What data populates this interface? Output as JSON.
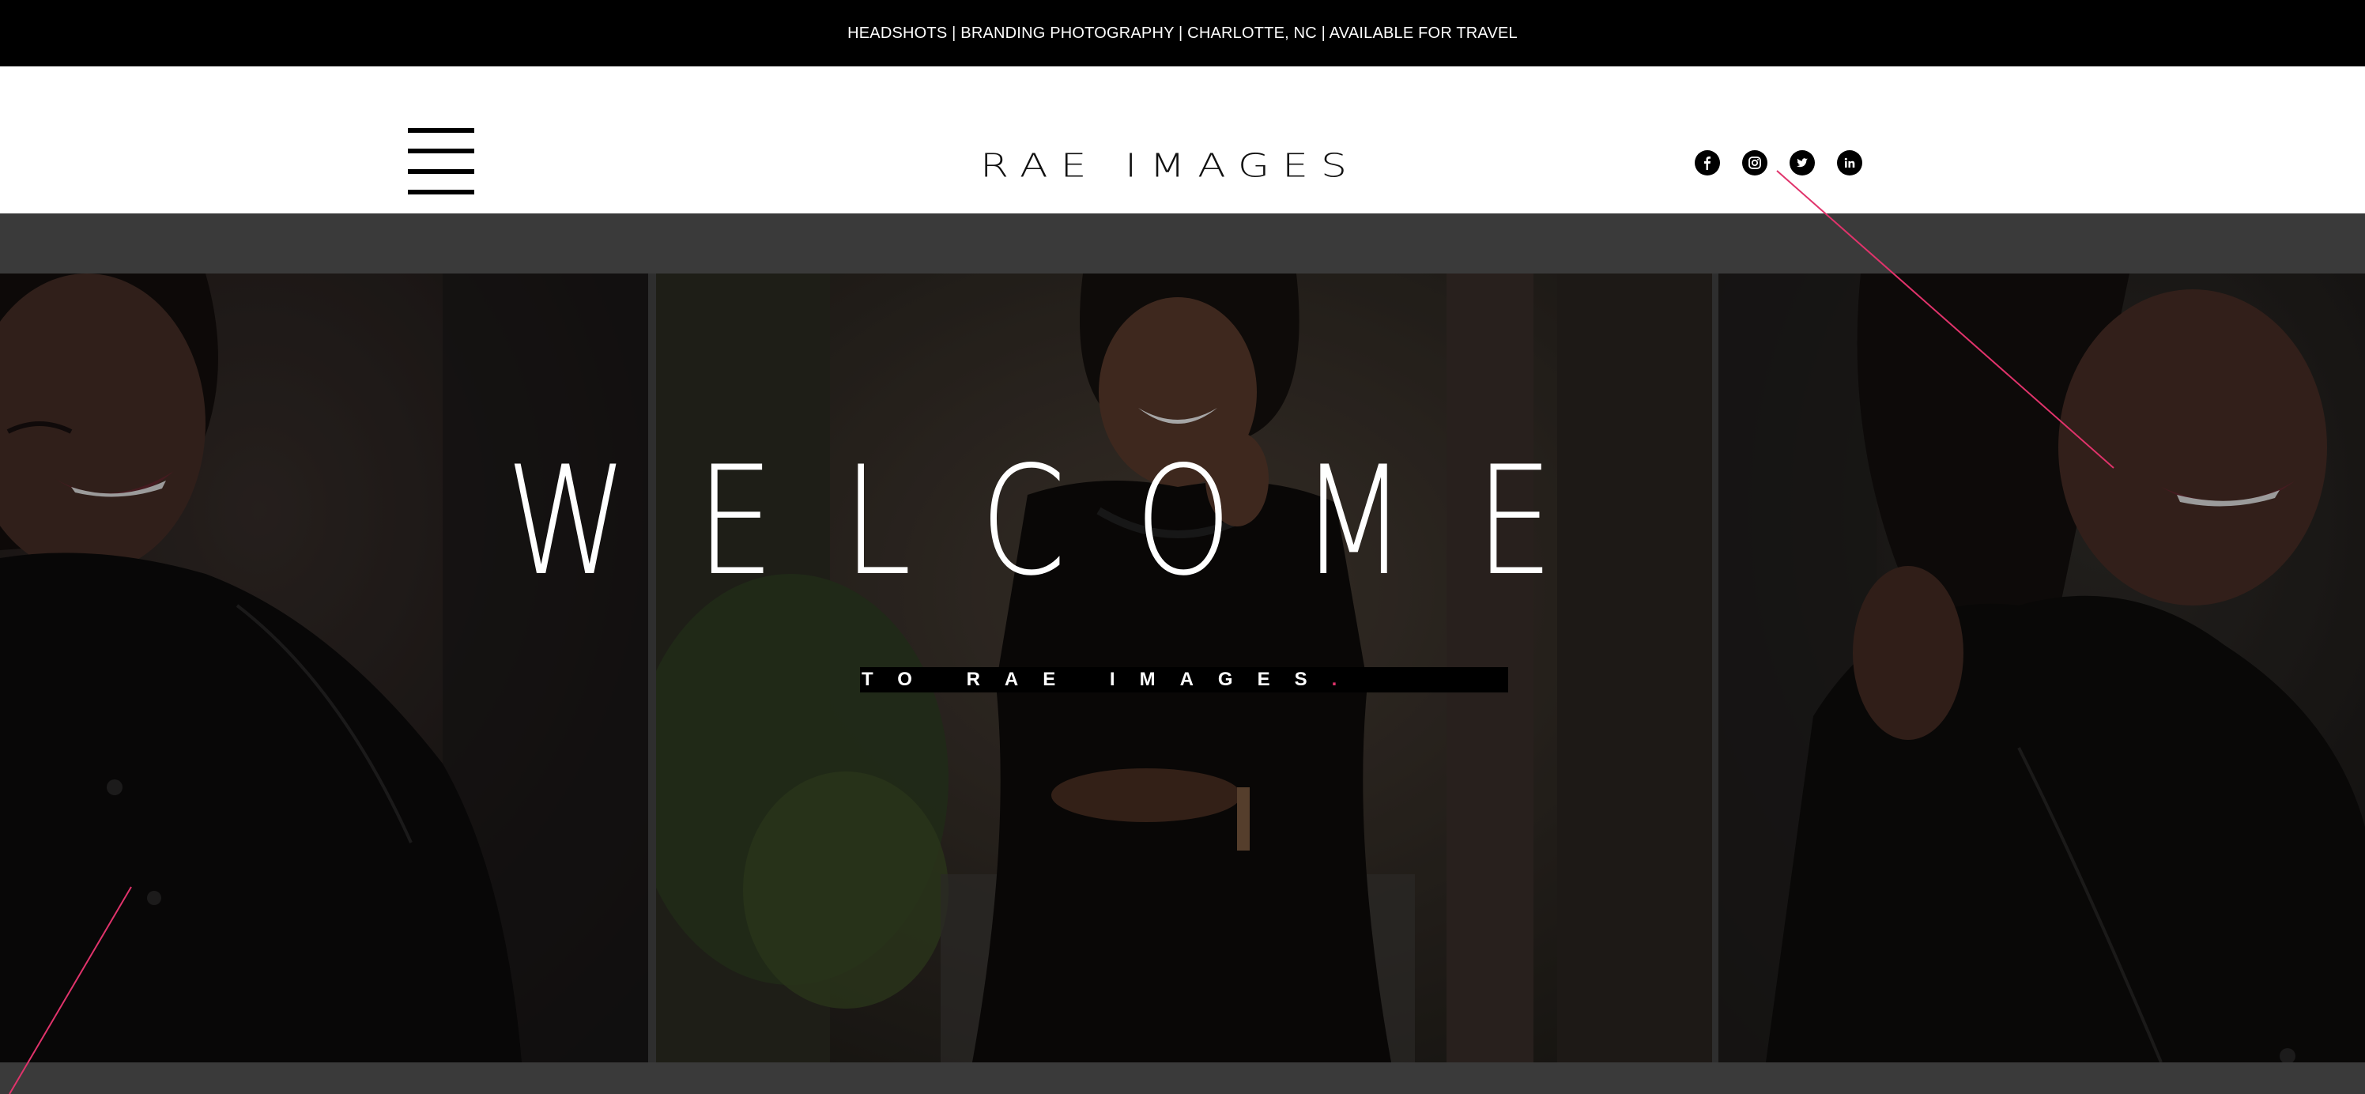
{
  "topbar": {
    "text": "HEADSHOTS | BRANDING PHOTOGRAPHY | CHARLOTTE, NC | AVAILABLE FOR TRAVEL"
  },
  "header": {
    "logo_text": "RAE IMAGES",
    "social_icons": [
      "facebook-icon",
      "instagram-icon",
      "twitter-icon",
      "linkedin-icon"
    ]
  },
  "hero": {
    "title": "WELCOME",
    "subtitle": "TO RAE IMAGES",
    "subtitle_dot": ".",
    "accent_color": "#e0336b"
  }
}
